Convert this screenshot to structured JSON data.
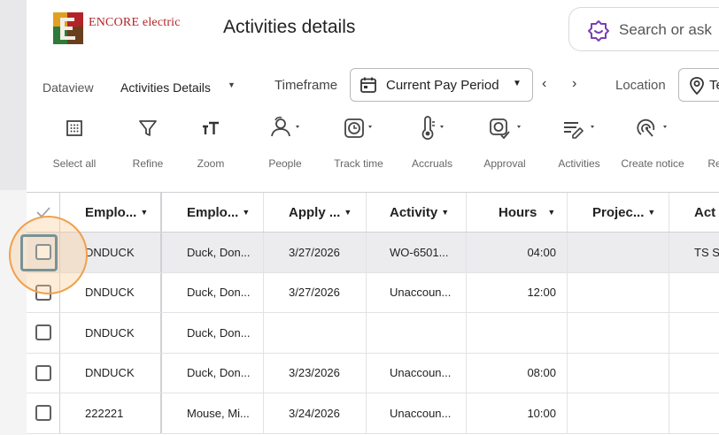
{
  "colors": {
    "brand_red": "#b2242a",
    "accent_purple": "#7b3fb5",
    "focus_blue": "#2d6e95",
    "highlight_orange": "#f0a04b"
  },
  "header": {
    "logo_text": "ENCORE electric",
    "title": "Activities details",
    "search_placeholder": "Search or ask"
  },
  "filters": {
    "dataview_label": "Dataview",
    "dataview_value": "Activities Details",
    "timeframe_label": "Timeframe",
    "timeframe_value": "Current Pay Period",
    "location_label": "Location",
    "location_value": "Te"
  },
  "toolbar": [
    {
      "label": "Select all",
      "icon": "select-all-icon"
    },
    {
      "label": "Refine",
      "icon": "filter-icon"
    },
    {
      "label": "Zoom",
      "icon": "text-size-icon"
    },
    {
      "label": "People",
      "icon": "people-icon"
    },
    {
      "label": "Track time",
      "icon": "clock-icon"
    },
    {
      "label": "Accruals",
      "icon": "thermometer-icon"
    },
    {
      "label": "Approval",
      "icon": "approval-icon"
    },
    {
      "label": "Activities",
      "icon": "activities-icon"
    },
    {
      "label": "Create notice",
      "icon": "notice-icon"
    },
    {
      "label": "Rec",
      "icon": "record-icon"
    }
  ],
  "table": {
    "columns": [
      "Emplo...",
      "Emplo...",
      "Apply ...",
      "Activity",
      "Hours",
      "Projec...",
      "Act"
    ],
    "rows": [
      {
        "c1": "DNDUCK",
        "c2": "Duck, Don...",
        "c3": "3/27/2026",
        "c4": "WO-6501...",
        "c5": "04:00",
        "c6": "",
        "c7": "TS Sc"
      },
      {
        "c1": "DNDUCK",
        "c2": "Duck, Don...",
        "c3": "3/27/2026",
        "c4": "Unaccoun...",
        "c5": "12:00",
        "c6": "",
        "c7": ""
      },
      {
        "c1": "DNDUCK",
        "c2": "Duck, Don...",
        "c3": "",
        "c4": "",
        "c5": "",
        "c6": "",
        "c7": ""
      },
      {
        "c1": "DNDUCK",
        "c2": "Duck, Don...",
        "c3": "3/23/2026",
        "c4": "Unaccoun...",
        "c5": "08:00",
        "c6": "",
        "c7": ""
      },
      {
        "c1": "222221",
        "c2": "Mouse, Mi...",
        "c3": "3/24/2026",
        "c4": "Unaccoun...",
        "c5": "10:00",
        "c6": "",
        "c7": ""
      }
    ]
  }
}
